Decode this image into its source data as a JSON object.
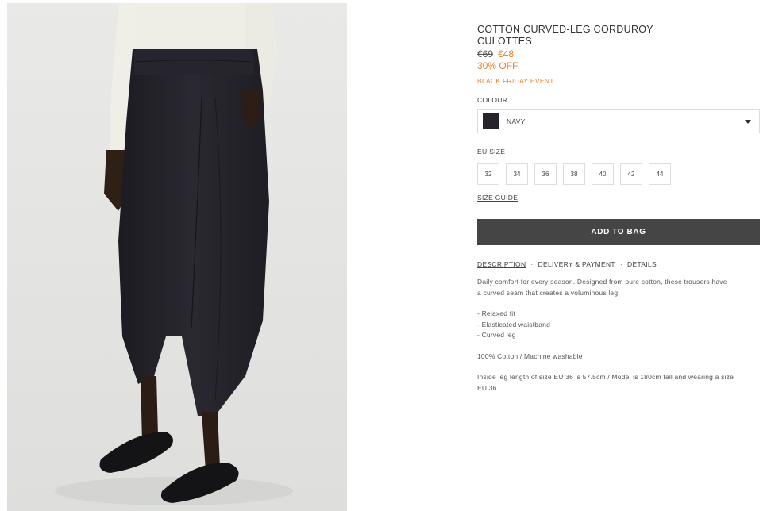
{
  "product": {
    "title_line1": "COTTON CURVED-LEG CORDUROY",
    "title_line2": "CULOTTES",
    "price_old": "€69",
    "price_new": "€48",
    "discount": "30% OFF",
    "event": "BLACK FRIDAY EVENT",
    "image_icon": "product-photo"
  },
  "colour": {
    "label": "COLOUR",
    "selected": "NAVY",
    "swatch_color": "#26232a"
  },
  "size": {
    "label": "EU SIZE",
    "options": [
      "32",
      "34",
      "36",
      "38",
      "40",
      "42",
      "44"
    ],
    "guide_label": "SIZE GUIDE"
  },
  "actions": {
    "add_to_bag": "ADD TO BAG"
  },
  "tabs": {
    "items": [
      "DESCRIPTION",
      "DELIVERY & PAYMENT",
      "DETAILS"
    ],
    "separator": "·",
    "active": "DESCRIPTION"
  },
  "description": {
    "intro_line1": "Daily comfort for every season. Designed from pure cotton, these trousers have",
    "intro_line2": "a curved seam that creates a voluminous leg.",
    "features": [
      "- Relaxed fit",
      "- Elasticated waistband",
      "- Curved leg"
    ],
    "composition": "100% Cotton / Machine washable",
    "fit_line1": "Inside leg length of size EU 36 is 57.5cm / Model is 180cm tall and wearing a size",
    "fit_line2": "EU 36"
  },
  "colors": {
    "accent": "#e8802f",
    "button_bg": "#454545",
    "trouser": "#23212a"
  }
}
